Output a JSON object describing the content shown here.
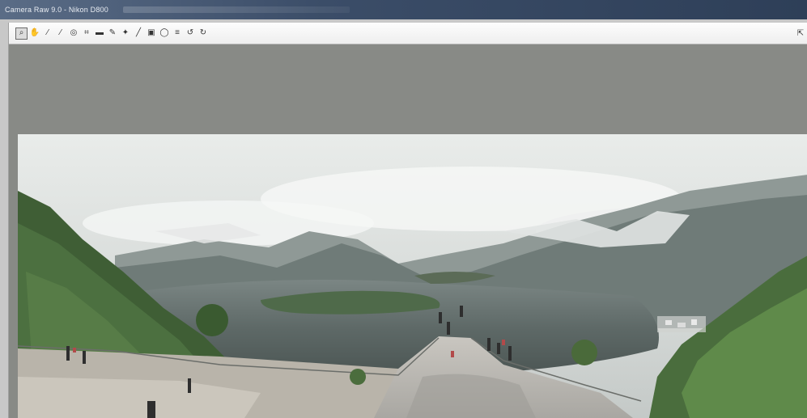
{
  "window": {
    "title": "Camera Raw 9.0 - Nikon D800"
  },
  "toolbar": {
    "tools": [
      {
        "name": "zoom-tool-icon",
        "glyph": "⌕",
        "active": true
      },
      {
        "name": "hand-tool-icon",
        "glyph": "✋",
        "active": false
      },
      {
        "name": "white-balance-tool-icon",
        "glyph": "⁄",
        "active": false
      },
      {
        "name": "color-sampler-tool-icon",
        "glyph": "⁄",
        "active": false
      },
      {
        "name": "targeted-adjustment-tool-icon",
        "glyph": "◎",
        "active": false
      },
      {
        "name": "crop-tool-icon",
        "glyph": "⌗",
        "active": false
      },
      {
        "name": "straighten-tool-icon",
        "glyph": "▬",
        "active": false
      },
      {
        "name": "spot-removal-tool-icon",
        "glyph": "✎",
        "active": false
      },
      {
        "name": "red-eye-removal-tool-icon",
        "glyph": "✦",
        "active": false
      },
      {
        "name": "adjustment-brush-tool-icon",
        "glyph": "╱",
        "active": false
      },
      {
        "name": "graduated-filter-tool-icon",
        "glyph": "▣",
        "active": false
      },
      {
        "name": "radial-filter-tool-icon",
        "glyph": "◯",
        "active": false
      },
      {
        "name": "preferences-icon",
        "glyph": "≡",
        "active": false
      },
      {
        "name": "rotate-left-icon",
        "glyph": "↺",
        "active": false
      },
      {
        "name": "rotate-right-icon",
        "glyph": "↻",
        "active": false
      }
    ],
    "right_tool": {
      "name": "fullscreen-toggle-icon",
      "glyph": "⇱"
    }
  }
}
